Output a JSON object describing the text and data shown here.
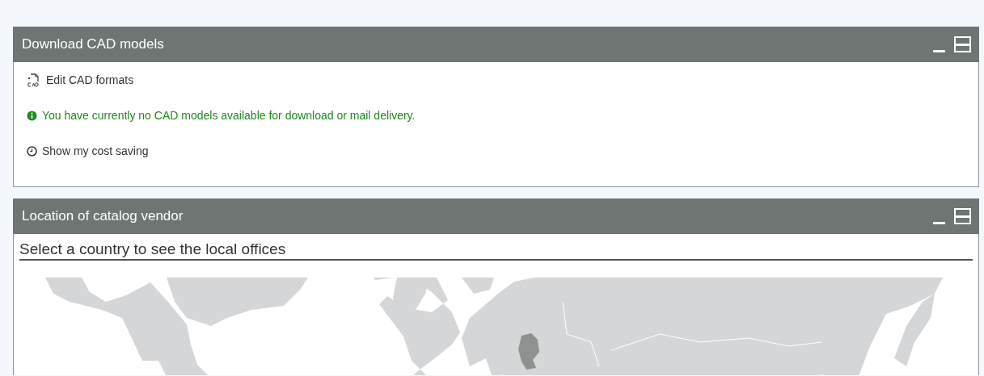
{
  "panels": [
    {
      "title": "Download CAD models",
      "kind": "actions",
      "items": [
        {
          "kind": "formats",
          "text": "Edit CAD formats"
        },
        {
          "kind": "info",
          "text": "You have currently no CAD models available for download or mail delivery."
        },
        {
          "kind": "saving",
          "text": "Show my cost saving"
        }
      ]
    },
    {
      "title": "Location of catalog vendor",
      "kind": "map",
      "heading": "Select a country to see the local offices"
    }
  ]
}
